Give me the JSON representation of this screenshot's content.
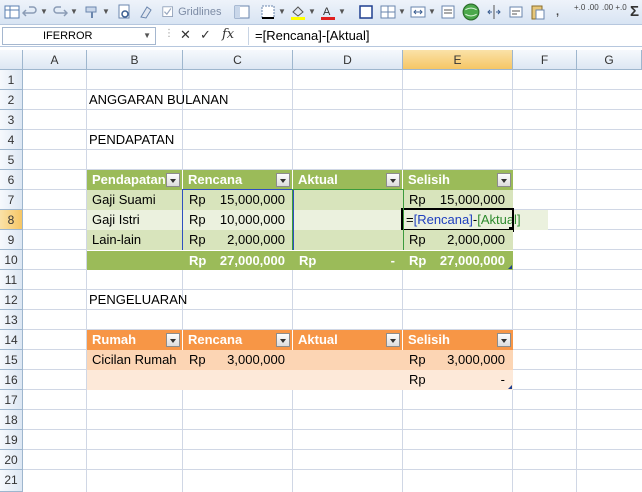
{
  "toolbar": {
    "gridlines_label": "Gridlines",
    "sigma": "Σ",
    "dec_inc": "+.0 .00",
    "dec_dec": ".00 +.0"
  },
  "formula_bar": {
    "name_box": "IFERROR",
    "cancel": "✕",
    "enter": "✓",
    "fx": "fx",
    "formula": "=[Rencana]-[Aktual]"
  },
  "columns": [
    "A",
    "B",
    "C",
    "D",
    "E",
    "F",
    "G"
  ],
  "selected_column": "E",
  "rows": [
    "1",
    "2",
    "3",
    "4",
    "5",
    "6",
    "7",
    "8",
    "9",
    "10",
    "11",
    "12",
    "13",
    "14",
    "15",
    "16",
    "17",
    "18",
    "19",
    "20",
    "21"
  ],
  "selected_row": "8",
  "sheet": {
    "title": "ANGGARAN BULANAN",
    "section_income": "PENDAPATAN",
    "section_expense": "PENGELUARAN",
    "income_table": {
      "headers": [
        "Pendapatan",
        "Rencana",
        "Aktual",
        "Selisih"
      ],
      "rows": [
        {
          "name": "Gaji Suami",
          "rencana_rp": "Rp",
          "rencana": "15,000,000",
          "selisih_rp": "Rp",
          "selisih": "15,000,000"
        },
        {
          "name": "Gaji Istri",
          "rencana_rp": "Rp",
          "rencana": "10,000,000",
          "editing_formula": "=[Rencana]-[Aktual]",
          "editing_eq": "=",
          "editing_ref1": "[Rencana]",
          "editing_op": "-",
          "editing_ref2": "[Aktual]"
        },
        {
          "name": "Lain-lain",
          "rencana_rp": "Rp",
          "rencana": "2,000,000",
          "selisih_rp": "Rp",
          "selisih": "2,000,000"
        }
      ],
      "total": {
        "rencana_rp": "Rp",
        "rencana": "27,000,000",
        "aktual_rp": "Rp",
        "aktual": "-",
        "selisih_rp": "Rp",
        "selisih": "27,000,000"
      }
    },
    "expense_table": {
      "headers": [
        "Rumah",
        "Rencana",
        "Aktual",
        "Selisih"
      ],
      "rows": [
        {
          "name": "Cicilan Rumah",
          "rencana_rp": "Rp",
          "rencana": "3,000,000",
          "selisih_rp": "Rp",
          "selisih": "3,000,000"
        },
        {
          "name": "",
          "selisih_rp": "Rp",
          "selisih": "-"
        }
      ]
    }
  },
  "colors": {
    "green_header": "#9bbb59",
    "orange_header": "#f79646",
    "ref_blue": "#1f3fbf",
    "ref_green": "#2e8b2e"
  }
}
